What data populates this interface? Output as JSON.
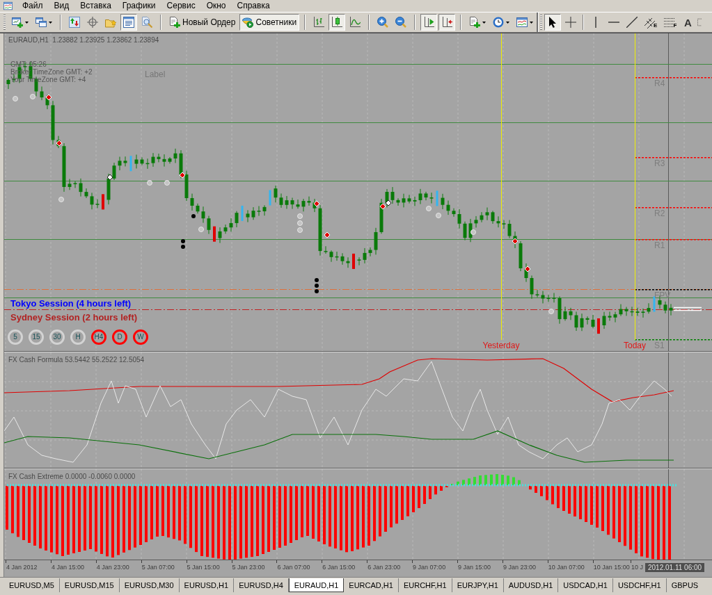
{
  "menu_bar": {
    "items": [
      "Файл",
      "Вид",
      "Вставка",
      "Графики",
      "Сервис",
      "Окно",
      "Справка"
    ]
  },
  "toolbars": [
    {
      "groups": [
        [
          {
            "pressed": false
          },
          {
            "pressed": false
          }
        ],
        [
          {
            "pressed": false
          },
          {
            "pressed": false
          },
          {
            "pressed": false
          },
          {
            "pressed": true
          },
          {
            "pressed": false
          }
        ],
        [
          {
            "label": "Новый Ордер",
            "pressed": false
          },
          {
            "label": "Советники",
            "pressed": true
          }
        ],
        [
          {
            "pressed": false
          },
          {
            "pressed": true
          },
          {
            "pressed": false
          }
        ],
        [
          {
            "pressed": false
          },
          {
            "pressed": false
          }
        ],
        [
          {
            "pressed": true
          },
          {
            "pressed": true
          }
        ],
        [
          {
            "pressed": false
          },
          {
            "pressed": false
          },
          {
            "pressed": false
          }
        ]
      ]
    },
    {
      "groups": [
        [
          {
            "pressed": true
          },
          {
            "pressed": false
          }
        ],
        [
          {
            "pressed": false
          },
          {
            "pressed": false
          },
          {
            "pressed": false
          },
          {
            "label": "E",
            "pressed": false
          },
          {
            "label": "F",
            "pressed": false
          },
          {
            "label": "A",
            "pressed": false
          },
          {
            "pressed": false
          }
        ]
      ]
    }
  ],
  "chart": {
    "title": "EURAUD,H1  1.23882 1.23925 1.23862 1.23894",
    "info_lines": [
      "GMT: 05:26",
      "Broker TimeZone GMT: +2",
      "Your TimeZone GMT: +4"
    ],
    "label": "Label",
    "levels": [
      {
        "label": "R4",
        "color": "#ff0000"
      },
      {
        "label": "R3",
        "color": "#ff0000"
      },
      {
        "label": "R2",
        "color": "#ff0000"
      },
      {
        "label": "R1",
        "color": "#ff0000"
      },
      {
        "label": "FPV",
        "color": "#000000"
      },
      {
        "label": "S1",
        "color": "#008000"
      }
    ],
    "day_separators": [
      {
        "label": "Yesterday"
      },
      {
        "label": "Today"
      }
    ],
    "sessions": [
      {
        "text": "Tokyo Session (4 hours left)",
        "color": "#0000ff"
      },
      {
        "text": "Sydney Session (2 hours left)",
        "color": "#b22222"
      }
    ],
    "timeframes": [
      {
        "label": "5",
        "color": "#d3d3d3"
      },
      {
        "label": "15",
        "color": "#d3d3d3"
      },
      {
        "label": "30",
        "color": "#d3d3d3"
      },
      {
        "label": "H",
        "color": "#d3d3d3"
      },
      {
        "label": "H4",
        "color": "#ff0000"
      },
      {
        "label": "D",
        "color": "#ff0000"
      },
      {
        "label": "W",
        "color": "#ff0000"
      }
    ]
  },
  "indicators": [
    {
      "kind": "lines",
      "title": "FX Cash Formula 53.5442 55.2522 12.5054"
    },
    {
      "kind": "histogram",
      "title": "FX Cash Extreme 0.0000 -0.0060 0.0000"
    }
  ],
  "time_axis": {
    "labels": [
      "4 Jan 2012",
      "4 Jan 15:00",
      "4 Jan 23:00",
      "5 Jan 07:00",
      "5 Jan 15:00",
      "5 Jan 23:00",
      "6 Jan 07:00",
      "6 Jan 15:00",
      "6 Jan 23:00",
      "9 Jan 07:00",
      "9 Jan 15:00",
      "9 Jan 23:00",
      "10 Jan 07:00",
      "10 Jan 15:00",
      "10 J"
    ],
    "cursor_time": "2012.01.11 06:00"
  },
  "tabs": [
    {
      "label": "EURUSD,M5",
      "selected": false
    },
    {
      "label": "EURUSD,M15",
      "selected": false
    },
    {
      "label": "EURUSD,M30",
      "selected": false
    },
    {
      "label": "EURUSD,H1",
      "selected": false
    },
    {
      "label": "EURUSD,H4",
      "selected": false
    },
    {
      "label": "EURAUD,H1",
      "selected": true
    },
    {
      "label": "EURCAD,H1",
      "selected": false
    },
    {
      "label": "EURCHF,H1",
      "selected": false
    },
    {
      "label": "EURJPY,H1",
      "selected": false
    },
    {
      "label": "AUDUSD,H1",
      "selected": false
    },
    {
      "label": "USDCAD,H1",
      "selected": false
    },
    {
      "label": "USDCHF,H1",
      "selected": false
    },
    {
      "label": "GBPUS",
      "selected": false
    }
  ]
}
